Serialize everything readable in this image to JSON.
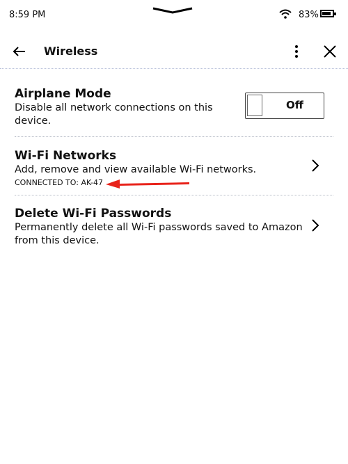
{
  "status_bar": {
    "time": "8:59 PM",
    "battery_percent_label": "83%",
    "battery_level": 0.83
  },
  "header": {
    "title": "Wireless"
  },
  "settings": [
    {
      "title": "Airplane Mode",
      "description": "Disable all network connections on this device.",
      "toggle_label": "Off",
      "toggle_on": false
    },
    {
      "title": "Wi-Fi Networks",
      "description": "Add, remove and view available Wi-Fi networks.",
      "subtext": "CONNECTED TO: AK-47"
    },
    {
      "title": "Delete Wi-Fi Passwords",
      "description": "Permanently delete all Wi-Fi passwords saved to Amazon from this device."
    }
  ],
  "annotation": {
    "arrow_color": "#e8231b"
  }
}
